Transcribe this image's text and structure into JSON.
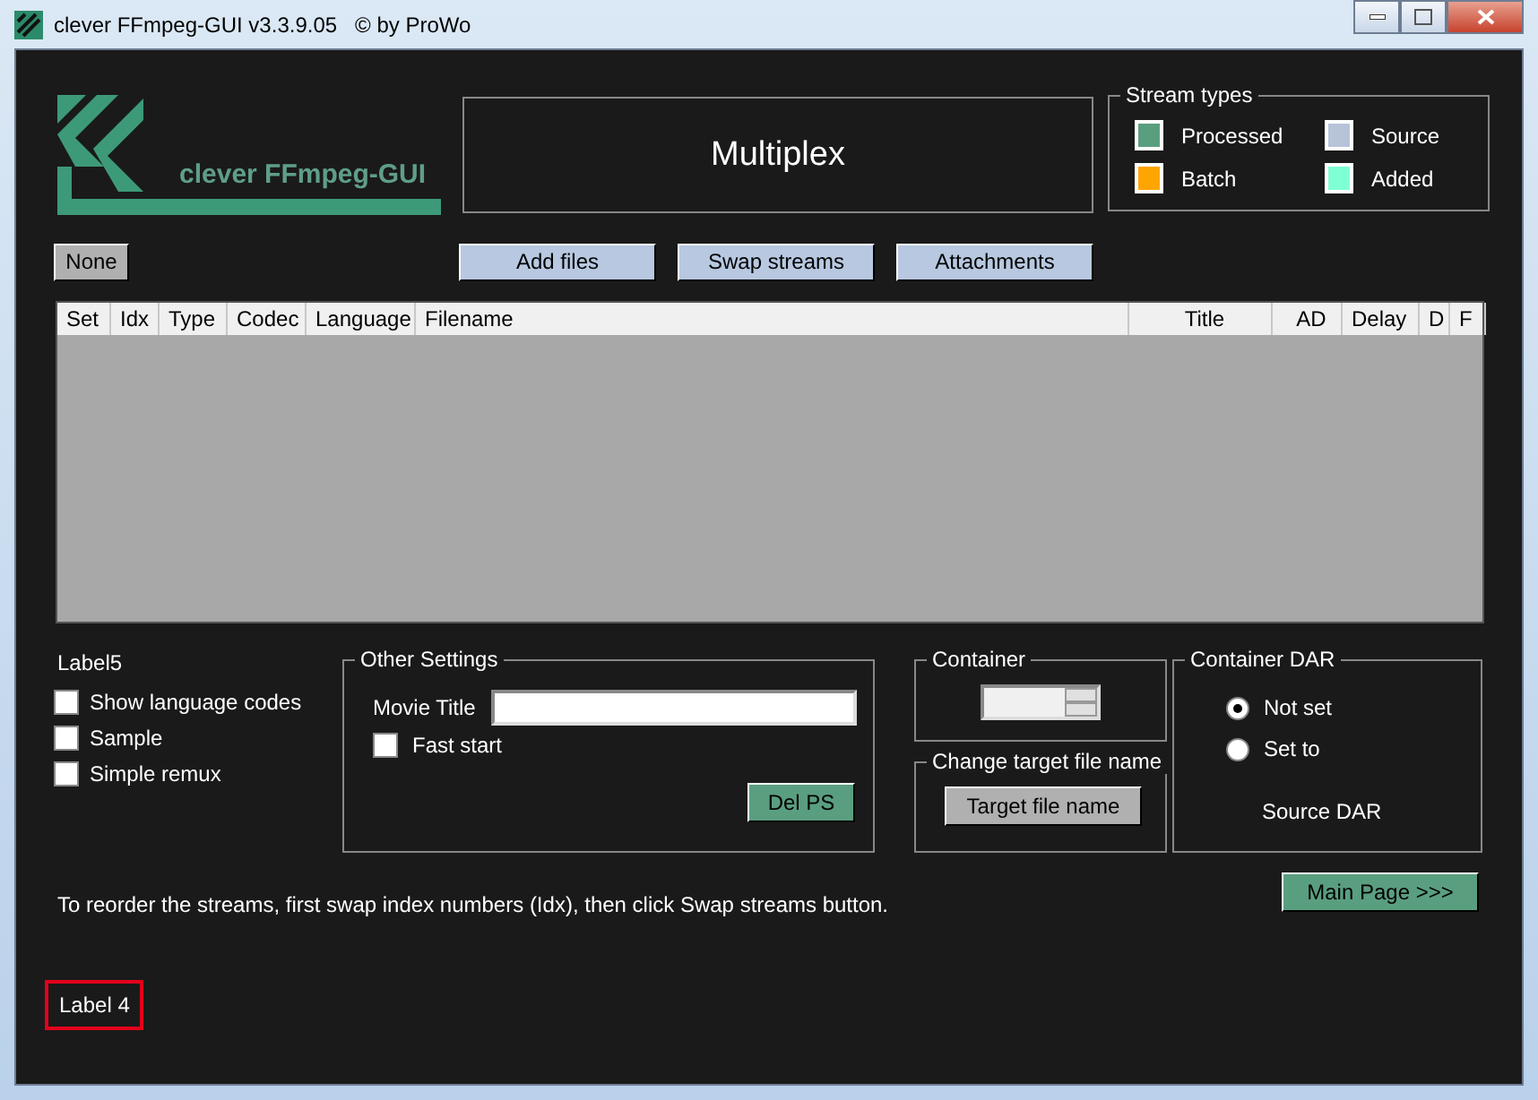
{
  "window": {
    "title": "clever FFmpeg-GUI v3.3.9.05   © by ProWo"
  },
  "logo": {
    "text": "clever FFmpeg-GUI"
  },
  "page_title": "Multiplex",
  "stream_types": {
    "title": "Stream types",
    "items": [
      {
        "label": "Processed",
        "color": "#5a9e80"
      },
      {
        "label": "Source",
        "color": "#b7c3d9"
      },
      {
        "label": "Batch",
        "color": "#ffa500"
      },
      {
        "label": "Added",
        "color": "#7fffd4"
      }
    ]
  },
  "none_button": "None",
  "toolbar": [
    "Add files",
    "Swap streams",
    "Attachments"
  ],
  "table": {
    "columns": [
      "Set",
      "Idx",
      "Type",
      "Codec",
      "Language",
      "Filename",
      "Title",
      "AD",
      "Delay",
      "D",
      "F"
    ]
  },
  "label5": "Label5",
  "options": [
    {
      "label": "Show language codes",
      "checked": false
    },
    {
      "label": "Sample",
      "checked": false
    },
    {
      "label": "Simple remux",
      "checked": false
    }
  ],
  "other_settings": {
    "title": "Other Settings",
    "movie_title_label": "Movie Title",
    "fast_start": {
      "label": "Fast start",
      "checked": false
    },
    "button": "Del PS"
  },
  "container": {
    "title": "Container"
  },
  "target": {
    "title": "Change target file name",
    "button": "Target file name"
  },
  "dar": {
    "title": "Container DAR",
    "options": [
      {
        "label": "Not set",
        "selected": true
      },
      {
        "label": "Set to",
        "selected": false
      }
    ],
    "source": "Source DAR"
  },
  "hint": "To reorder the streams, first swap index numbers (Idx), then click Swap streams button.",
  "main_page_button": "Main Page >>>",
  "label4": "Label 4"
}
